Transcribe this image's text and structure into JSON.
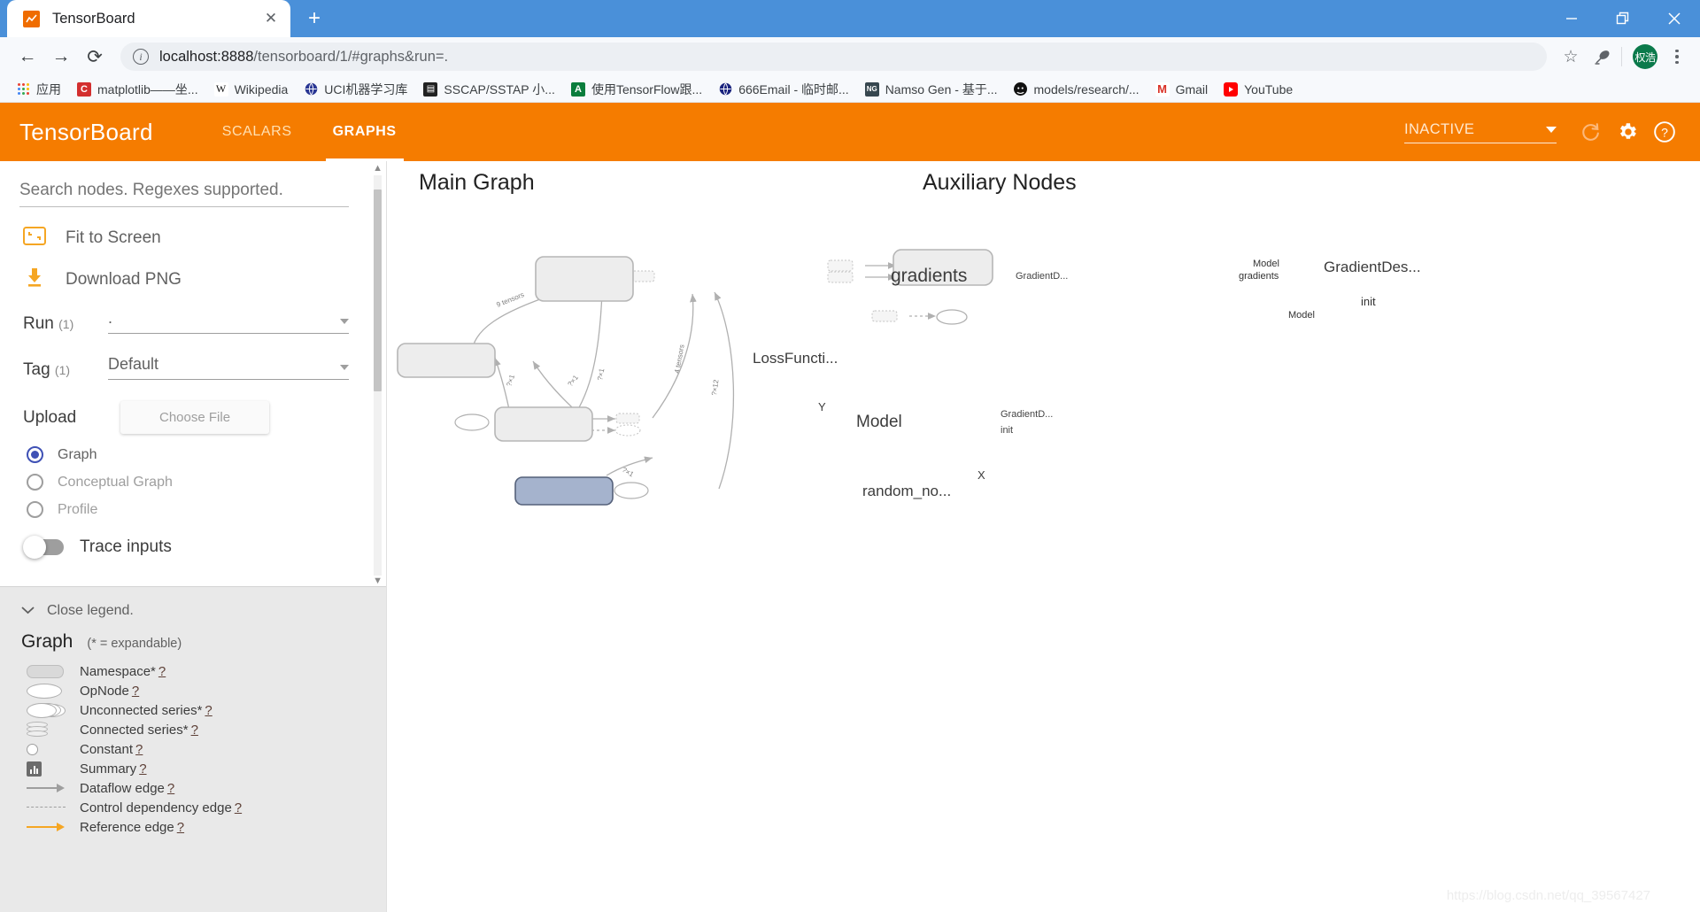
{
  "browser": {
    "tab": {
      "title": "TensorBoard",
      "favicon": "chart-line-icon",
      "close": "✕"
    },
    "newtab_label": "+",
    "window_controls": {
      "minimize": "—",
      "maximize": "❐",
      "close": "✕"
    },
    "nav": {
      "back": "←",
      "forward": "→",
      "reload": "⟳"
    },
    "omnibox": {
      "info_icon": "i",
      "url_host": "localhost:8888",
      "url_path": "/tensorboard/1/#graphs&run=.",
      "url_full": "localhost:8888/tensorboard/1/#graphs&run=."
    },
    "star_icon": "☆",
    "extension_icon": "satellite-dish-icon",
    "profile_initials": "权浩",
    "bookmarks": [
      {
        "label": "应用",
        "icon": "apps-grid-icon",
        "icon_color": "#4285f4"
      },
      {
        "label": "matplotlib——坐...",
        "icon": "C",
        "icon_color": "#d32f2f"
      },
      {
        "label": "Wikipedia",
        "icon": "W",
        "icon_color": "#ffffff"
      },
      {
        "label": "UCI机器学习库",
        "icon": "globe-icon",
        "icon_color": "#283593"
      },
      {
        "label": "SSCAP/SSTAP 小...",
        "icon": "app-icon",
        "icon_color": "#212121"
      },
      {
        "label": "使用TensorFlow跟...",
        "icon": "A",
        "icon_color": "#0a7d3c"
      },
      {
        "label": "666Email - 临时邮...",
        "icon": "globe-icon",
        "icon_color": "#1a237e"
      },
      {
        "label": "Namso Gen - 基于...",
        "icon": "NG",
        "icon_color": "#37474f"
      },
      {
        "label": "models/research/...",
        "icon": "github-icon",
        "icon_color": "#111111"
      },
      {
        "label": "Gmail",
        "icon": "M",
        "icon_color": "#d93025"
      },
      {
        "label": "YouTube",
        "icon": "play-icon",
        "icon_color": "#ff0000"
      }
    ]
  },
  "tensorboard": {
    "logo": "TensorBoard",
    "tabs": [
      {
        "label": "SCALARS",
        "active": false
      },
      {
        "label": "GRAPHS",
        "active": true
      }
    ],
    "run_status": "INACTIVE",
    "header_icons": {
      "refresh": "refresh-icon",
      "settings": "gear-icon",
      "help": "help-circle-icon"
    },
    "accent_color": "#f57c00"
  },
  "sidebar": {
    "search_placeholder": "Search nodes. Regexes supported.",
    "search_value": "",
    "actions": [
      {
        "label": "Fit to Screen",
        "icon": "fit-to-screen-icon"
      },
      {
        "label": "Download PNG",
        "icon": "download-icon"
      }
    ],
    "run": {
      "label": "Run",
      "count": "(1)",
      "value": "."
    },
    "tag": {
      "label": "Tag",
      "count": "(1)",
      "value": "Default"
    },
    "upload": {
      "label": "Upload",
      "button": "Choose File"
    },
    "radios": [
      {
        "label": "Graph",
        "selected": true,
        "disabled": false
      },
      {
        "label": "Conceptual Graph",
        "selected": false,
        "disabled": true
      },
      {
        "label": "Profile",
        "selected": false,
        "disabled": true
      }
    ],
    "trace_inputs": {
      "label": "Trace inputs",
      "on": false
    }
  },
  "legend": {
    "close_label": "Close legend.",
    "title": "Graph",
    "subtitle": "(* = expandable)",
    "items": [
      {
        "label": "Namespace*",
        "help": "?",
        "symbol": "namespace-shape"
      },
      {
        "label": "OpNode",
        "help": "?",
        "symbol": "opnode-shape"
      },
      {
        "label": "Unconnected series*",
        "help": "?",
        "symbol": "unconnected-series-shape"
      },
      {
        "label": "Connected series*",
        "help": "?",
        "symbol": "connected-series-shape"
      },
      {
        "label": "Constant",
        "help": "?",
        "symbol": "constant-shape"
      },
      {
        "label": "Summary",
        "help": "?",
        "symbol": "summary-shape"
      },
      {
        "label": "Dataflow edge",
        "help": "?",
        "symbol": "dataflow-edge"
      },
      {
        "label": "Control dependency edge",
        "help": "?",
        "symbol": "control-dependency-edge"
      },
      {
        "label": "Reference edge",
        "help": "?",
        "symbol": "reference-edge"
      }
    ]
  },
  "graph": {
    "main_title": "Main Graph",
    "aux_title": "Auxiliary Nodes",
    "watermark": "https://blog.csdn.net/qq_39567427",
    "main_nodes": [
      {
        "id": "gradients",
        "label": "gradients",
        "type": "namespace"
      },
      {
        "id": "lossfunction",
        "label": "LossFuncti...",
        "type": "namespace"
      },
      {
        "id": "model",
        "label": "Model",
        "type": "namespace"
      },
      {
        "id": "random_normal",
        "label": "random_no...",
        "type": "namespace-highlight"
      },
      {
        "id": "Y",
        "label": "Y",
        "type": "opnode"
      },
      {
        "id": "X",
        "label": "X",
        "type": "opnode"
      },
      {
        "id": "grad_out_gd",
        "label": "GradientD...",
        "type": "annotation"
      },
      {
        "id": "model_out_gd",
        "label": "GradientD...",
        "type": "annotation"
      },
      {
        "id": "model_out_init",
        "label": "init",
        "type": "annotation"
      }
    ],
    "main_edge_labels": [
      "9 tensors",
      "?×1",
      "?×1",
      "?×1",
      "?×1",
      "4 tensors",
      "?×12",
      "?×1"
    ],
    "aux_nodes": [
      {
        "id": "gradientdescent",
        "label": "GradientDes...",
        "type": "namespace",
        "inputs": [
          "Model",
          "gradients"
        ]
      },
      {
        "id": "init",
        "label": "init",
        "type": "opnode",
        "inputs": [
          "Model"
        ]
      }
    ],
    "colors": {
      "node_fill": "#ededed",
      "node_stroke": "#b6b6b6",
      "highlight_fill": "#a5b3cd",
      "highlight_stroke": "#55617a",
      "edge": "#b0b0b0"
    }
  }
}
